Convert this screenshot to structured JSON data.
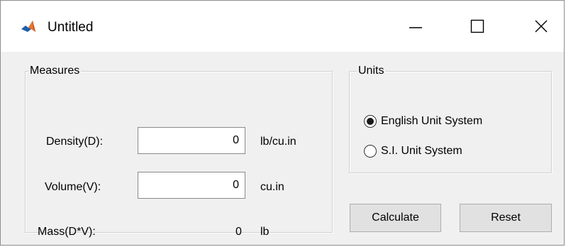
{
  "window": {
    "title": "Untitled",
    "icon": "matlab-icon",
    "controls": {
      "minimize": "—",
      "maximize": "☐",
      "close": "✕"
    }
  },
  "measures": {
    "title": "Measures",
    "density_label": "Density(D):",
    "density_value": "0",
    "density_unit": "lb/cu.in",
    "volume_label": "Volume(V):",
    "volume_value": "0",
    "volume_unit": "cu.in",
    "mass_label": "Mass(D*V):",
    "mass_value": "0",
    "mass_unit": "lb"
  },
  "units": {
    "title": "Units",
    "options": [
      {
        "label": "English Unit System",
        "selected": true
      },
      {
        "label": "S.I. Unit System",
        "selected": false
      }
    ]
  },
  "buttons": {
    "calculate": "Calculate",
    "reset": "Reset"
  }
}
